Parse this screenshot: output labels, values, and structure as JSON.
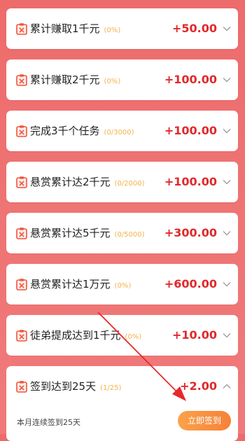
{
  "colors": {
    "accent": "#e0292b",
    "progress": "#f2b24a",
    "button": "#f5823a",
    "background": "#ee6b6b"
  },
  "tasks": [
    {
      "title": "累计赚取1千元",
      "progress": "(0%)",
      "amount": "+50.00",
      "chevron": "chevron-down-icon"
    },
    {
      "title": "累计赚取2千元",
      "progress": "(0%)",
      "amount": "+100.00",
      "chevron": "chevron-down-icon"
    },
    {
      "title": "完成3千个任务",
      "progress": "(0/3000)",
      "amount": "+100.00",
      "chevron": "chevron-down-icon"
    },
    {
      "title": "悬赏累计达2千元",
      "progress": "(0/2000)",
      "amount": "+100.00",
      "chevron": "chevron-down-icon"
    },
    {
      "title": "悬赏累计达5千元",
      "progress": "(0/5000)",
      "amount": "+300.00",
      "chevron": "chevron-down-icon"
    },
    {
      "title": "悬赏累计达1万元",
      "progress": "(0%)",
      "amount": "+600.00",
      "chevron": "chevron-down-icon"
    },
    {
      "title": "徒弟提成达到1千元",
      "progress": "(0%)",
      "amount": "+10.00",
      "chevron": "chevron-down-icon"
    },
    {
      "title": "签到达到25天",
      "progress": "(1/25)",
      "amount": "+2.00",
      "chevron": "chevron-up-icon",
      "detail": "本月连续签到25天",
      "button_label": "立即签到"
    }
  ]
}
